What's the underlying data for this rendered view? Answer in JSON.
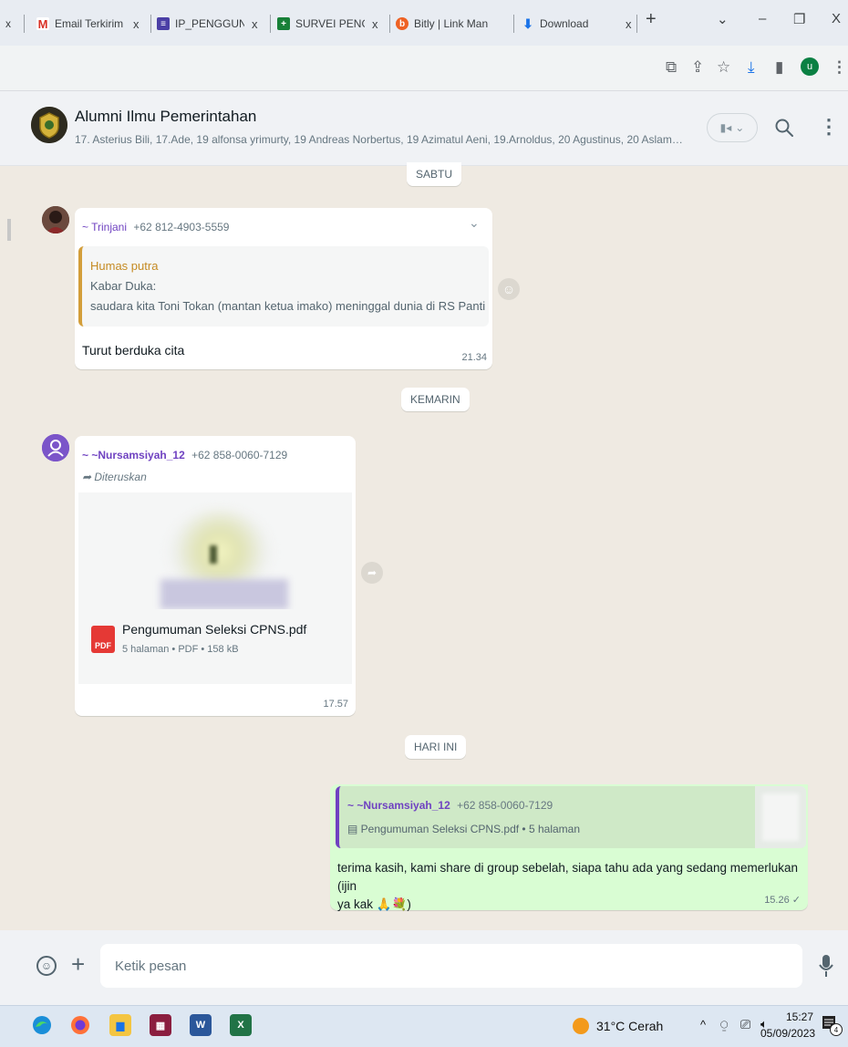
{
  "browser": {
    "tabs": [
      {
        "label": "Email Terkirim -",
        "favicon": "gmail-icon",
        "color": "#d93025",
        "glyph": "M"
      },
      {
        "label": "IP_PENGGUNA",
        "favicon": "sheets-icon",
        "color": "#4b3fa6",
        "glyph": "≡"
      },
      {
        "label": "SURVEI PENGG",
        "favicon": "forms-icon",
        "color": "#188038",
        "glyph": "+"
      },
      {
        "label": "Bitly | Link Man",
        "favicon": "bitly-icon",
        "color": "#ee6123",
        "glyph": "b"
      },
      {
        "label": "Download",
        "favicon": "download-icon",
        "color": "#1a73e8",
        "glyph": "⬇"
      }
    ],
    "tab_close": "x",
    "new_tab": "+",
    "window_controls": {
      "dropdown": "⌄",
      "minimize": "–",
      "maximize": "❐",
      "close": "X"
    },
    "profile_initial": "u",
    "accent": "#0b8043"
  },
  "chat": {
    "title": "Alumni Ilmu Pemerintahan",
    "members": "17. Asterius Bili, 17.Ade, 19 alfonsa yrimurty, 19 Andreas Norbertus, 19 Azimatul Aeni, 19.Arnoldus, 20 Agustinus, 20 Aslam, 2..."
  },
  "dates": {
    "d1": "SABTU",
    "d2": "KEMARIN",
    "d3": "HARI INI"
  },
  "messages": {
    "m1": {
      "sender": "~ Trinjani",
      "phone": "+62 812-4903-5559",
      "quote_author": "Humas putra",
      "quote_line1": "Kabar Duka:",
      "quote_line2": "saudara kita Toni Tokan (mantan ketua imako) meninggal dunia di RS Panti Rapih..",
      "text": "Turut berduka cita",
      "time": "21.34"
    },
    "m2": {
      "sender": "~ ~Nursamsiyah_12",
      "phone": "+62 858-0060-7129",
      "forwarded": "Diteruskan",
      "file_name": "Pengumuman Seleksi CPNS.pdf",
      "file_meta": "5 halaman • PDF • 158 kB",
      "file_badge": "PDF",
      "time": "17.57"
    },
    "m3": {
      "quote_sender": "~ ~Nursamsiyah_12",
      "quote_phone": "+62 858-0060-7129",
      "quote_file": "Pengumuman Seleksi CPNS.pdf • 5 halaman",
      "text_line1": "terima kasih, kami share di group sebelah, siapa tahu ada yang sedang memerlukan (ijin",
      "text_line2": "ya kak 🙏💐)",
      "time": "15.26 ✓"
    }
  },
  "composer": {
    "placeholder": "Ketik pesan"
  },
  "taskbar": {
    "weather": "31°C  Cerah",
    "time": "15:27",
    "date": "05/09/2023",
    "notifications": "4"
  }
}
